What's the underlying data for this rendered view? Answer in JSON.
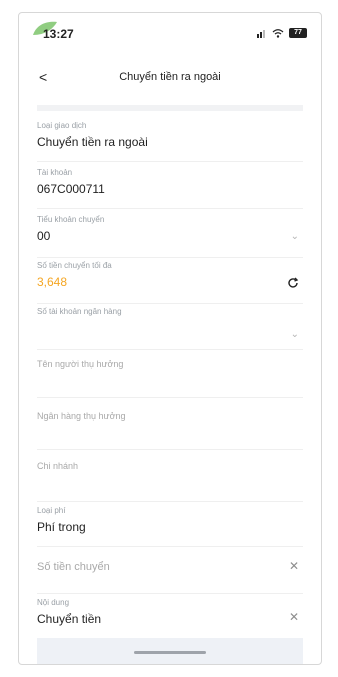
{
  "status_bar": {
    "time": "13:27",
    "battery": "77"
  },
  "header": {
    "back_label": "<",
    "title": "Chuyển tiền ra ngoài"
  },
  "form": {
    "loai_giao_dich": {
      "label": "Loại giao dịch",
      "value": "Chuyển tiền ra ngoài"
    },
    "tai_khoan": {
      "label": "Tài khoản",
      "value": "067C000711"
    },
    "tieu_khoan": {
      "label": "Tiểu khoản chuyển",
      "value": "00"
    },
    "so_tien_toi_da": {
      "label": "Số tiền chuyển tối đa",
      "value": "3,648",
      "value_color": "#f5a623"
    },
    "so_tai_khoan_ngan_hang": {
      "label": "Số tài khoản ngân hàng"
    },
    "ten_nguoi_thu_huong": {
      "placeholder": "Tên người thụ hưởng"
    },
    "ngan_hang_thu_huong": {
      "placeholder": "Ngân hàng thụ hưởng"
    },
    "chi_nhanh": {
      "placeholder": "Chi nhánh"
    },
    "loai_phi": {
      "label": "Loại phí",
      "value": "Phí trong"
    },
    "so_tien_chuyen": {
      "placeholder": "Số tiền chuyển"
    },
    "noi_dung": {
      "label": "Nội dung",
      "value": "Chuyển tiền"
    }
  },
  "icons": {
    "chevron": "chevron-down-icon",
    "clear": "close-icon",
    "refresh": "refresh-icon"
  },
  "glyphs": {
    "chevron": "⌄",
    "clear": "✕"
  }
}
